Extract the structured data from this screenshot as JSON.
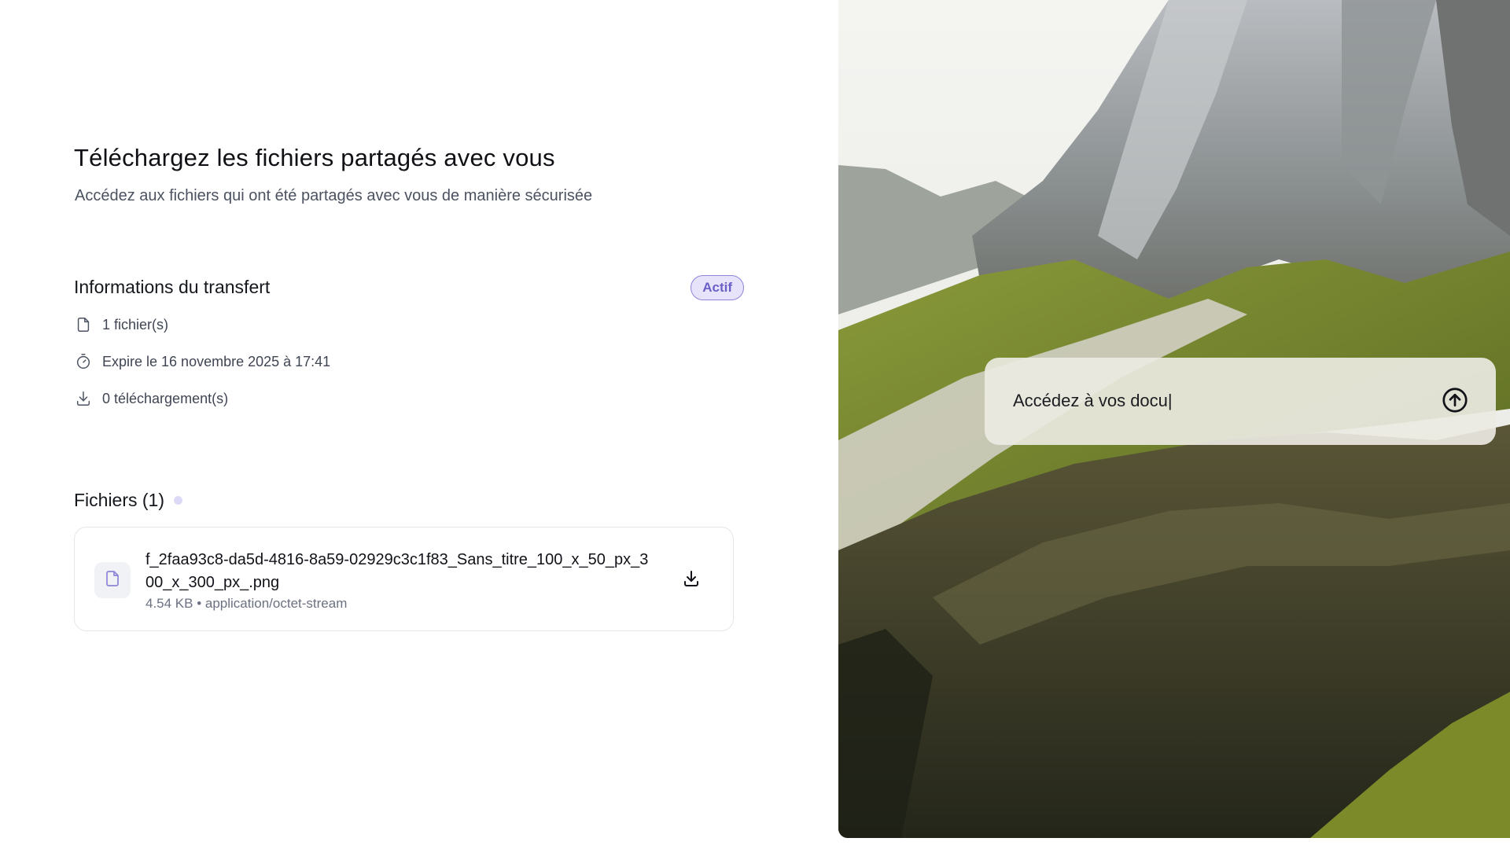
{
  "header": {
    "title": "Téléchargez les fichiers partagés avec vous",
    "subtitle": "Accédez aux fichiers qui ont été partagés avec vous de manière sécurisée"
  },
  "transfer": {
    "section_title": "Informations du transfert",
    "status_badge": "Actif",
    "rows": [
      {
        "icon": "file-icon",
        "text": "1 fichier(s)"
      },
      {
        "icon": "timer-icon",
        "text": "Expire le 16 novembre 2025 à 17:41"
      },
      {
        "icon": "download-icon",
        "text": "0 téléchargement(s)"
      }
    ]
  },
  "files": {
    "section_title": "Fichiers (1)",
    "items": [
      {
        "name": "f_2faa93c8-da5d-4816-8a59-02929c3c1f83_Sans_titre_100_x_50_px_300_x_300_px_.png",
        "meta": "4.54 KB • application/octet-stream",
        "icon": "file-icon"
      }
    ]
  },
  "prompt": {
    "value": "Accédez à vos docu|",
    "send_icon": "arrow-up-circle-icon"
  },
  "colors": {
    "accent": "#6a60c8",
    "badge_bg": "#e6e3fb",
    "text_primary": "#111318",
    "text_secondary": "#4b5260"
  }
}
